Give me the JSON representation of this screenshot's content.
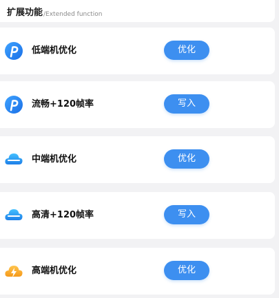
{
  "header": {
    "title": "扩展功能",
    "subtitle": "/Extended function"
  },
  "items": [
    {
      "label": "低端机优化",
      "button": "优化",
      "icon": "p-logo-icon"
    },
    {
      "label": "流畅+120帧率",
      "button": "写入",
      "icon": "p-logo-icon"
    },
    {
      "label": "中端机优化",
      "button": "优化",
      "icon": "cloud-icon"
    },
    {
      "label": "高清+120帧率",
      "button": "写入",
      "icon": "cloud-icon"
    },
    {
      "label": "高端机优化",
      "button": "优化",
      "icon": "cloud-lightning-icon"
    }
  ],
  "colors": {
    "accent": "#3d8ff0",
    "background": "#f2f2f4",
    "card": "#ffffff",
    "lightning": "#f5a623"
  }
}
